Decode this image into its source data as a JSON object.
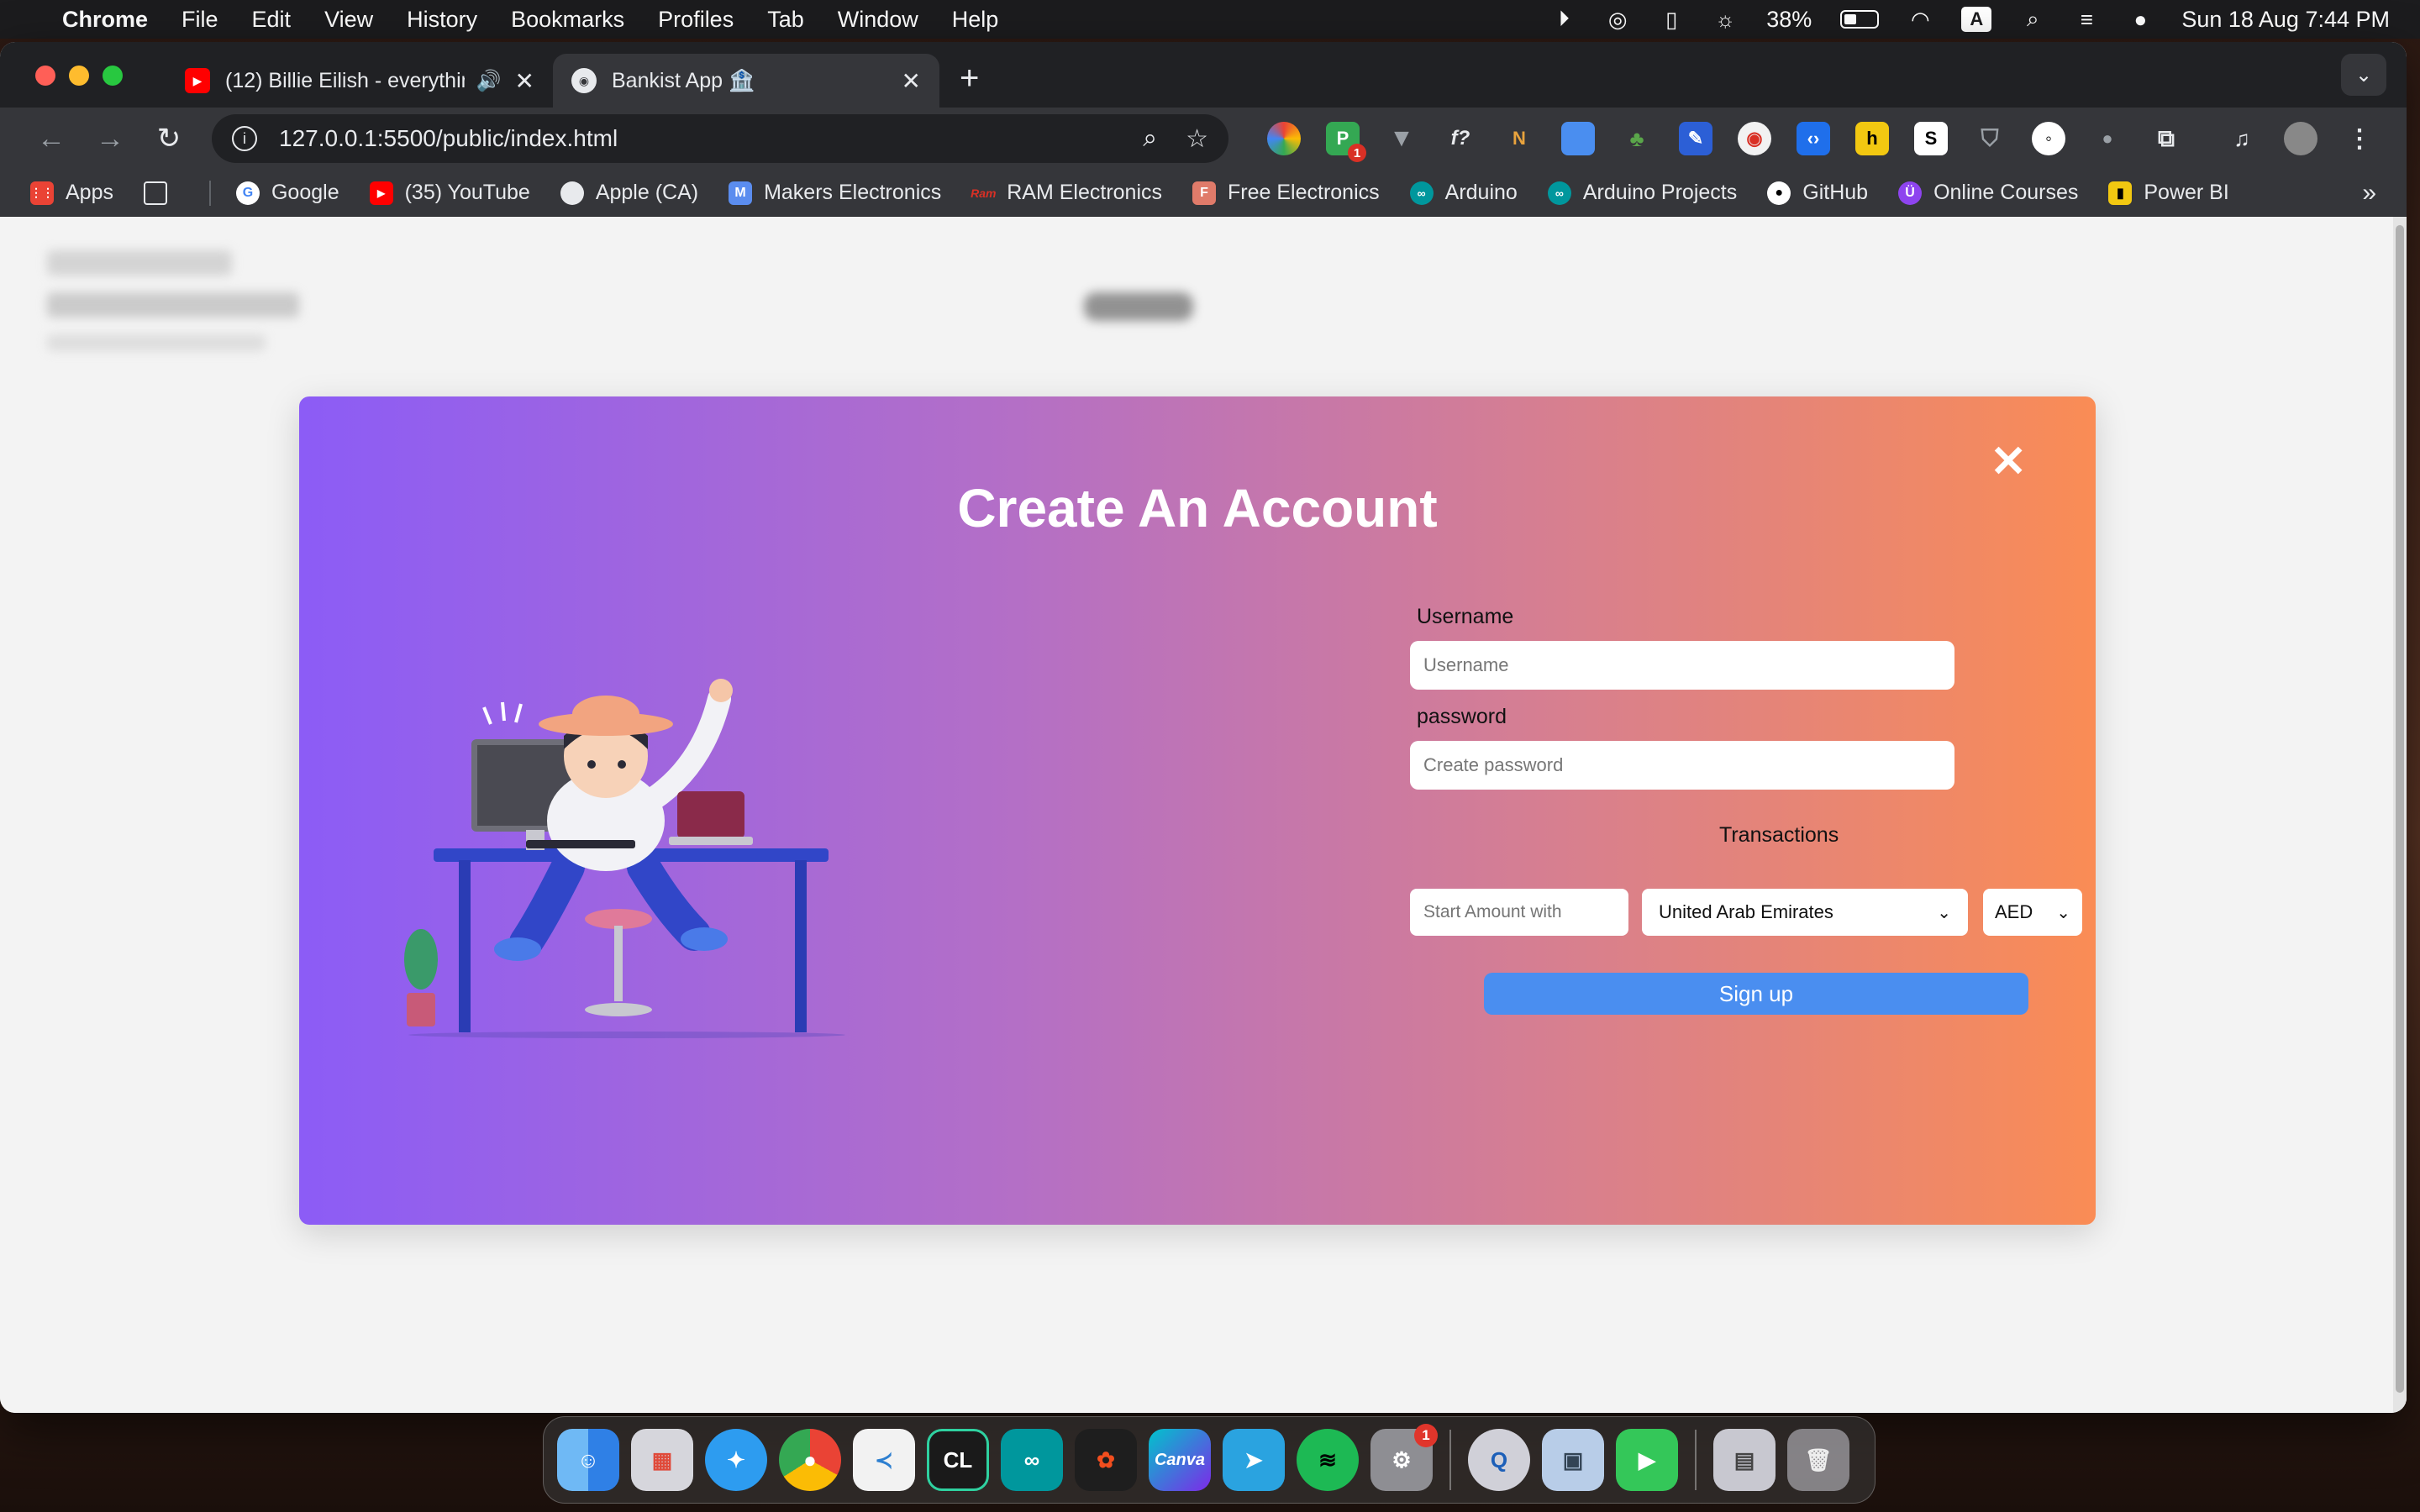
{
  "menubar": {
    "app_name": "Chrome",
    "menus": [
      "File",
      "Edit",
      "View",
      "History",
      "Bookmarks",
      "Profiles",
      "Tab",
      "Window",
      "Help"
    ],
    "battery_percent": "38%",
    "input_source": "A",
    "datetime": "Sun 18 Aug  7:44 PM"
  },
  "tabs": [
    {
      "title": "(12) Billie Eilish - everything",
      "favicon": "youtube-icon",
      "active": false
    },
    {
      "title": "Bankist App 🏦",
      "favicon": "page-icon",
      "active": true
    }
  ],
  "toolbar": {
    "url": "127.0.0.1:5500/public/index.html",
    "extension_badge": "1"
  },
  "bookmarks": [
    {
      "label": "Apps",
      "icon": "apps-grid-icon",
      "color": "#ea4335"
    },
    {
      "label": "Google",
      "icon": "google-icon",
      "color": "#4285f4"
    },
    {
      "label": "(35) YouTube",
      "icon": "youtube-icon",
      "color": "#ff0000"
    },
    {
      "label": "Apple (CA)",
      "icon": "apple-icon",
      "color": "#e8eaed"
    },
    {
      "label": "Makers Electronics",
      "icon": "makers-icon",
      "color": "#5b8def"
    },
    {
      "label": "RAM Electronics",
      "icon": "ram-icon",
      "color": "#d93025"
    },
    {
      "label": "Free Electronics",
      "icon": "free-electronics-icon",
      "color": "#e07b6a"
    },
    {
      "label": "Arduino",
      "icon": "arduino-icon",
      "color": "#00979d"
    },
    {
      "label": "Arduino Projects",
      "icon": "arduino-icon",
      "color": "#00979d"
    },
    {
      "label": "GitHub",
      "icon": "github-icon",
      "color": "#ffffff"
    },
    {
      "label": "Online Courses",
      "icon": "courses-icon",
      "color": "#8e44ef"
    },
    {
      "label": "Power BI",
      "icon": "powerbi-icon",
      "color": "#f2c811"
    }
  ],
  "modal": {
    "title": "Create An Account",
    "close_symbol": "✕",
    "username_label": "Username",
    "username_placeholder": "Username",
    "password_label": "password",
    "password_placeholder": "Create password",
    "transactions_label": "Transactions",
    "amount_placeholder": "Start Amount with",
    "country_selected": "United Arab Emirates",
    "currency_selected": "AED",
    "signup_label": "Sign up",
    "colors": {
      "gradient_start": "#8c5cf6",
      "gradient_end": "#fa8c55",
      "signup_button": "#4a8ef0"
    }
  },
  "dock": {
    "apps": [
      "Finder",
      "Launchpad",
      "Safari",
      "Chrome",
      "VS Code",
      "CLion",
      "Arduino",
      "Figma",
      "Canva",
      "Telegram",
      "Spotify",
      "System Settings",
      "QuickTime",
      "Preview",
      "FaceTime",
      "Downloads",
      "Trash"
    ],
    "settings_badge": "1"
  }
}
